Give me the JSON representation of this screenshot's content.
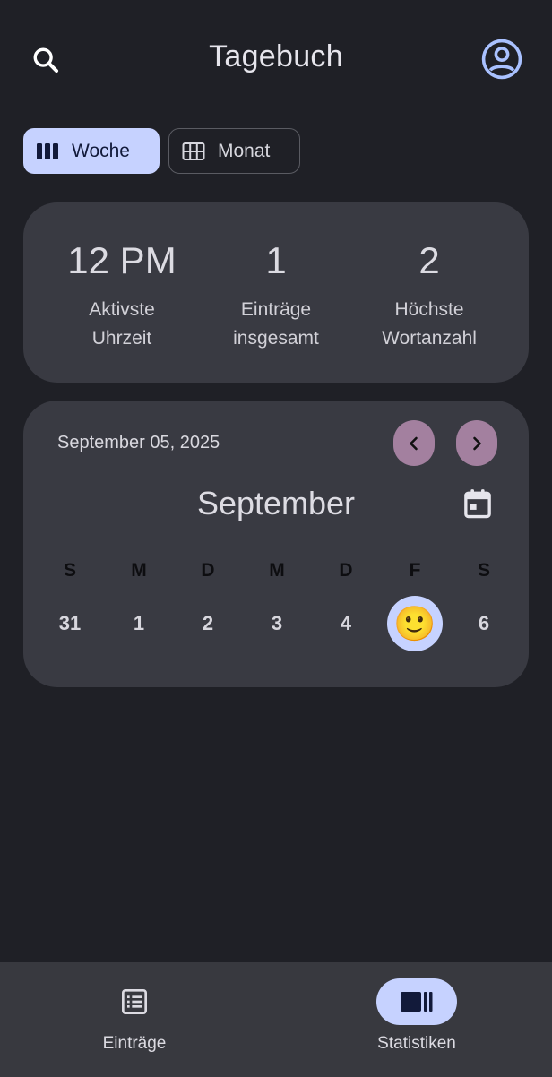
{
  "header": {
    "title": "Tagebuch",
    "search_icon": "search-icon",
    "account_icon": "account-circle-icon"
  },
  "view_toggle": {
    "week_label": "Woche",
    "month_label": "Monat",
    "selected": "Woche"
  },
  "stats": [
    {
      "value": "12 PM",
      "label": "Aktivste\nUhrzeit"
    },
    {
      "value": "1",
      "label": "Einträge\ninsgesamt"
    },
    {
      "value": "2",
      "label": "Höchste\nWortanzahl"
    }
  ],
  "calendar": {
    "date_label": "September 05, 2025",
    "month": "September",
    "weekdays": [
      "S",
      "M",
      "D",
      "M",
      "D",
      "F",
      "S"
    ],
    "days": [
      "31",
      "1",
      "2",
      "3",
      "4",
      "",
      "6"
    ],
    "selected_day_emoji": "🙂"
  },
  "bottom_nav": {
    "items": [
      {
        "label": "Einträge",
        "icon": "list-icon",
        "active": false
      },
      {
        "label": "Statistiken",
        "icon": "stats-icon",
        "active": true
      }
    ]
  },
  "colors": {
    "background": "#1f2026",
    "card": "#393a42",
    "accent": "#c6d2ff",
    "nav_button": "#a3809f",
    "account_icon": "#a9c1ff"
  }
}
